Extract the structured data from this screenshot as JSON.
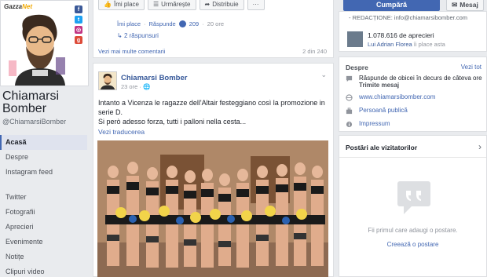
{
  "profile": {
    "logo_prefix": "Gazza",
    "logo_suffix": "Net",
    "name": "Chiamarsi Bomber",
    "handle": "@ChiamarsiBomber"
  },
  "nav": [
    {
      "label": "Acasă",
      "active": true
    },
    {
      "label": "Despre"
    },
    {
      "label": "Instagram feed"
    },
    {
      "label": "Twitter"
    },
    {
      "label": "Fotografii"
    },
    {
      "label": "Aprecieri"
    },
    {
      "label": "Evenimente"
    },
    {
      "label": "Notițe"
    },
    {
      "label": "Clipuri video"
    }
  ],
  "top_actions": {
    "like": "Îmi place",
    "follow": "Urmărește",
    "share": "Distribuie",
    "more": "···"
  },
  "comment": {
    "like": "Îmi place",
    "sep": "·",
    "reply": "Răspunde",
    "reactions": "209",
    "time": "20 ore",
    "replies": "2 răspunsuri",
    "more_comments": "Vezi mai multe comentarii",
    "count": "2 din 240"
  },
  "post": {
    "author": "Chiamarsi Bomber",
    "time": "23 ore",
    "text_line1": "Intanto a Vicenza le ragazze dell'Altair festeggiano così la promozione in serie D.",
    "text_line2": "Si però adesso forza, tutti i palloni nella cesta...",
    "translate": "Vezi traducerea"
  },
  "right": {
    "buy": "Cumpără",
    "message": "Mesaj",
    "redaction_line": "- REDACȚIONE:  info@chiamarsibomber.com",
    "likes_count": "1.078.616 de aprecieri",
    "likes_friend_name": "Lui Adrian Florea",
    "likes_friend_suffix": " îi place asta",
    "about_title": "Despre",
    "about_link": "Vezi tot",
    "about_response": "Răspunde de obicei în decurs de câteva ore",
    "about_send": "Trimite mesaj",
    "about_site": "www.chiamarsibomber.com",
    "about_category": "Persoană publică",
    "about_impressum": "Impressum",
    "visitors_title": "Postări ale vizitatorilor",
    "visitors_empty": "Fii primul care adaugi o postare.",
    "visitors_create": "Creează o postare"
  },
  "colors": {
    "accent": "#4267b2",
    "link": "#365899",
    "bg": "#e9ebee"
  }
}
